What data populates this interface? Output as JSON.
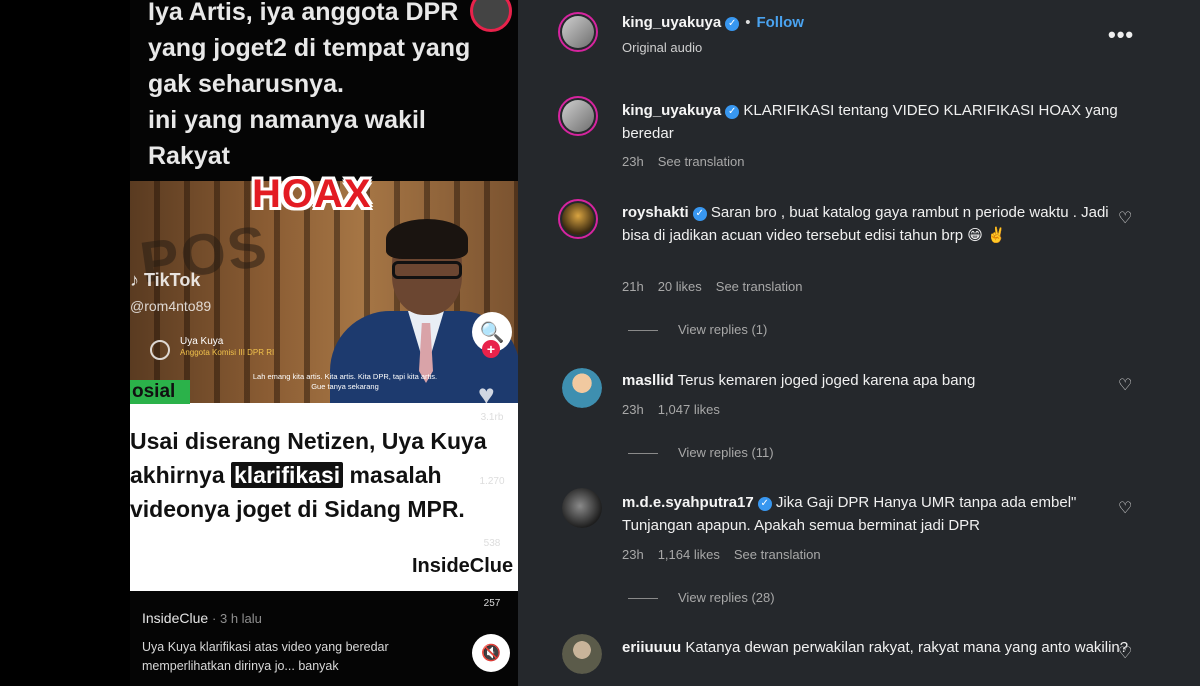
{
  "video": {
    "caption_lines": [
      "Iya Artis, iya anggota DPR",
      "yang joget2 di tempat yang",
      "gak seharusnya.",
      "ini yang namanya wakil",
      "Rakyat"
    ],
    "hoax_label": "HOAX",
    "wall_text": "POS",
    "tiktok_mark": "♪ TikTok",
    "tiktok_user": "@rom4nto89",
    "lower_third_name": "Uya Kuya",
    "lower_third_role": "Anggota Komisi III DPR RI",
    "subtitle": "Lah emang kita artis. Kita artis. Kita DPR, tapi kita artis. Gue tanya sekarang",
    "sosial_tag": "osial",
    "headline": {
      "line1": "Usai diserang Netizen, Uya Kuya",
      "line2_pre": "akhirnya ",
      "line2_highlight": "klarifikasi",
      "line2_post": " masalah",
      "line3": "videonya joget di Sidang MPR."
    },
    "logo_text": "InsideClue",
    "rail": {
      "likes": "3.1rb",
      "comments": "1.270",
      "saves": "538",
      "shares": "257"
    },
    "author": "InsideClue",
    "posted_ago": "· 3 h lalu",
    "description": "Uya Kuya klarifikasi atas video yang beredar memperlihatkan dirinya jo... banyak"
  },
  "post_header": {
    "username": "king_uyakuya",
    "verified": "✓",
    "separator": "•",
    "follow_label": "Follow",
    "audio_label": "Original audio",
    "more_label": "•••"
  },
  "comments": [
    {
      "username": "king_uyakuya",
      "verified": true,
      "text": "KLARIFIKASI tentang VIDEO KLARIFIKASI HOAX yang beredar",
      "time": "23h",
      "likes": "",
      "translate": "See translation",
      "replies": ""
    },
    {
      "username": "royshakti",
      "verified": true,
      "text": "Saran bro , buat katalog gaya rambut n periode waktu . Jadi bisa di jadikan acuan video tersebut edisi tahun brp 😁 ✌️",
      "time": "21h",
      "likes": "20 likes",
      "translate": "See translation",
      "replies": "View replies (1)"
    },
    {
      "username": "masllid",
      "verified": false,
      "text": "Terus kemaren joged joged karena apa bang",
      "time": "23h",
      "likes": "1,047 likes",
      "translate": "",
      "replies": "View replies (11)"
    },
    {
      "username": "m.d.e.syahputra17",
      "verified": true,
      "text": "Jika Gaji DPR Hanya UMR tanpa ada embel\" Tunjangan apapun. Apakah semua berminat jadi DPR",
      "time": "23h",
      "likes": "1,164 likes",
      "translate": "See translation",
      "replies": "View replies (28)"
    },
    {
      "username": "eriiuuuu",
      "verified": false,
      "text": "Katanya dewan perwakilan rakyat, rakyat mana yang anto wakilin?",
      "time": "",
      "likes": "",
      "translate": "",
      "replies": ""
    }
  ],
  "icons": {
    "heart": "♡",
    "search": "🔍",
    "mute": "🔇"
  },
  "colors": {
    "panel_bg": "#25282c",
    "link_blue": "#4aa3f0",
    "verified_blue": "#3897f0",
    "hoax_red": "#e31b23",
    "sosial_green": "#2bb24a"
  }
}
